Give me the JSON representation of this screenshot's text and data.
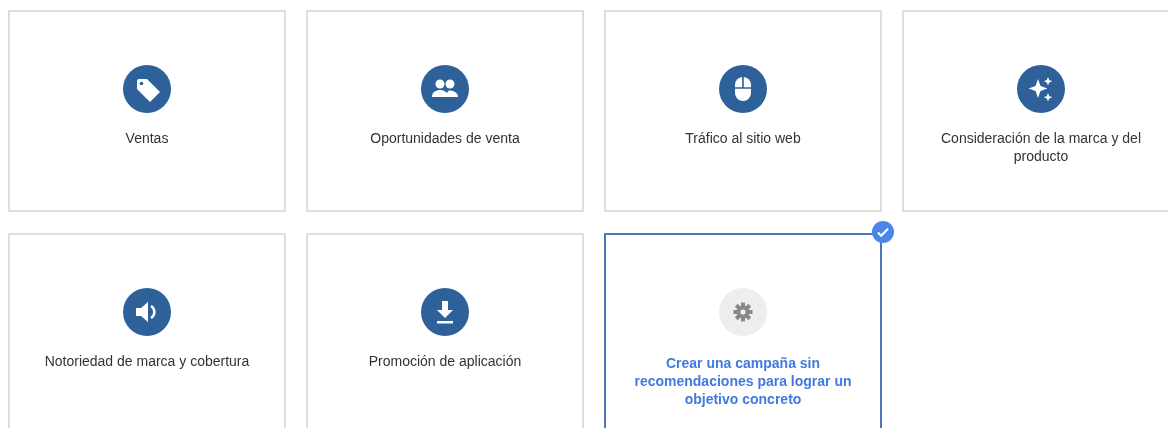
{
  "goals": [
    {
      "label": "Ventas",
      "kind": "goal",
      "selected": false
    },
    {
      "label": "Oportunidades de venta",
      "kind": "goal",
      "selected": false
    },
    {
      "label": "Tráfico al sitio web",
      "kind": "goal",
      "selected": false
    },
    {
      "label": "Consideración de la marca y del producto",
      "kind": "goal",
      "selected": false
    },
    {
      "label": "Notoriedad de marca y cobertura",
      "kind": "goal",
      "selected": false
    },
    {
      "label": "Promoción de aplicación",
      "kind": "goal",
      "selected": false
    },
    {
      "label": "Crear una campaña sin recomendaciones para lograr un objetivo concreto",
      "kind": "custom",
      "selected": true
    }
  ]
}
